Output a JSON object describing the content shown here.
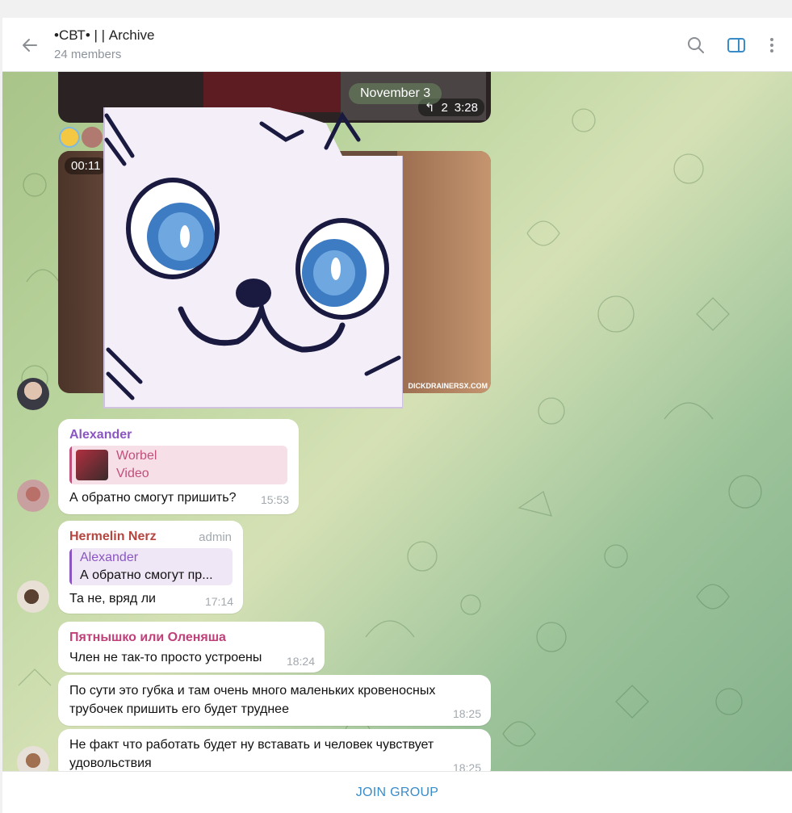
{
  "header": {
    "title": "•СВТ• | | Archive",
    "subtitle": "24 members"
  },
  "date_badge": "November 3",
  "top_video": {
    "replies": "2",
    "time": "3:28"
  },
  "second_video": {
    "duration": "00:11",
    "watermark": "DICKDRAINERSX.COM"
  },
  "messages": [
    {
      "sender": "Alexander",
      "sender_color": "#8a56c2",
      "reply_to": {
        "name": "Worbel",
        "text": "Video",
        "color": "#c0507a"
      },
      "text": "А обратно смогут пришить?",
      "time": "15:53"
    },
    {
      "sender": "Hermelin Nerz",
      "sender_color": "#b5463f",
      "badge": "admin",
      "reply_to": {
        "name": "Alexander",
        "text": "А обратно смогут пр...",
        "color": "#8a56c2"
      },
      "text": "Та не, вряд ли",
      "time": "17:14"
    },
    {
      "sender": "Пятнышко или Оленяша",
      "sender_color": "#c0407a",
      "text": "Член не так-то просто устроены",
      "time": "18:24"
    },
    {
      "text_line1": "По сути это губка и там очень много маленьких кровеносных",
      "text_line2": "трубочек пришить его  будет труднее",
      "time": "18:25"
    },
    {
      "text_line1": "Не факт что работать будет ну вставать и человек чувствует",
      "text_line2": "удовольствия",
      "time": "18:25"
    }
  ],
  "footer": {
    "join_label": "JOIN GROUP"
  }
}
